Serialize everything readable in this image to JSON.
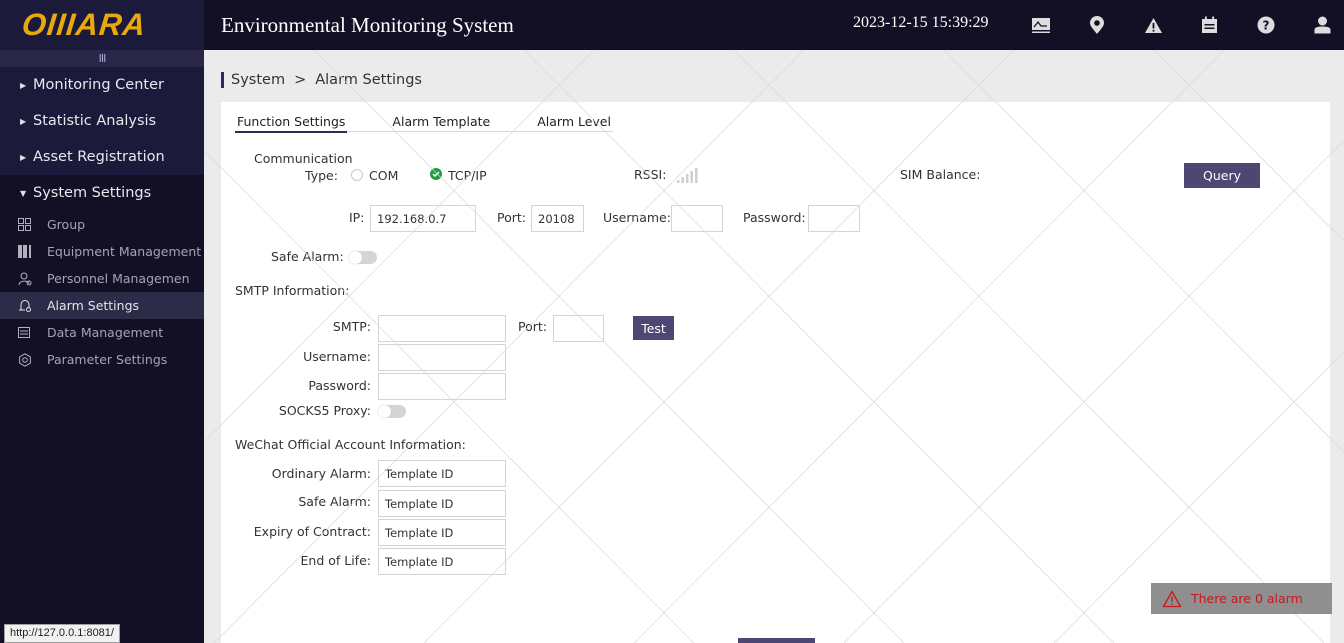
{
  "brand": {
    "logo": "OIIIARA",
    "collapse_glyph": "III"
  },
  "header": {
    "title": "Environmental Monitoring System",
    "datetime": "2023-12-15 15:39:29",
    "icons": [
      "chart-monitor-icon",
      "location-pin-icon",
      "warning-icon",
      "calendar-icon",
      "help-icon",
      "user-icon"
    ]
  },
  "sidebar": {
    "main_items": [
      {
        "label": "Monitoring Center",
        "expanded": false
      },
      {
        "label": "Statistic Analysis",
        "expanded": false
      },
      {
        "label": "Asset Registration",
        "expanded": false
      },
      {
        "label": "System Settings",
        "expanded": true
      }
    ],
    "sub_items": [
      {
        "label": "Group",
        "icon": "group-icon"
      },
      {
        "label": "Equipment Management",
        "icon": "equipment-icon"
      },
      {
        "label": "Personnel Managemen",
        "icon": "personnel-icon"
      },
      {
        "label": "Alarm Settings",
        "icon": "alarm-bell-icon",
        "active": true
      },
      {
        "label": "Data Management",
        "icon": "data-list-icon"
      },
      {
        "label": "Parameter Settings",
        "icon": "gear-icon"
      }
    ]
  },
  "breadcrumb": {
    "parent": "System",
    "separator": ">",
    "current": "Alarm Settings"
  },
  "tabs": [
    {
      "label": "Function Settings",
      "active": true
    },
    {
      "label": "Alarm Template",
      "active": false
    },
    {
      "label": "Alarm Level",
      "active": false
    }
  ],
  "communication": {
    "label_line1": "Communication",
    "label_line2": "Type:",
    "options": [
      {
        "label": "COM",
        "selected": false
      },
      {
        "label": "TCP/IP",
        "selected": true
      }
    ],
    "rssi_label": "RSSI:",
    "sim_balance_label": "SIM Balance:",
    "sim_balance_value": "",
    "query_button": "Query",
    "ip_label": "IP:",
    "ip_value": "192.168.0.7",
    "port_label": "Port:",
    "port_value": "20108",
    "username_label": "Username:",
    "username_value": "",
    "password_label": "Password:",
    "password_value": ""
  },
  "safe_alarm": {
    "label": "Safe Alarm:",
    "enabled": false
  },
  "smtp": {
    "section_label": "SMTP Information:",
    "smtp_label": "SMTP:",
    "smtp_value": "",
    "port_label": "Port:",
    "port_value": "",
    "test_button": "Test",
    "username_label": "Username:",
    "username_value": "",
    "password_label": "Password:",
    "password_value": "",
    "socks5_label": "SOCKS5 Proxy:",
    "socks5_enabled": false
  },
  "wechat": {
    "section_label": "WeChat Official Account Information:",
    "fields": [
      {
        "label": "Ordinary Alarm:",
        "value": "Template ID"
      },
      {
        "label": "Safe Alarm:",
        "value": "Template ID"
      },
      {
        "label": "Expiry of Contract:",
        "value": "Template ID"
      },
      {
        "label": "End of Life:",
        "value": "Template ID"
      }
    ]
  },
  "alarm_toast": {
    "text": "There are 0 alarm",
    "color": "#c8171e"
  },
  "status_bar": {
    "url": "http://127.0.0.1:8081/"
  },
  "colors": {
    "accent": "#4c4773",
    "logo": "#e9a90c",
    "nav_bg": "#131026",
    "success": "#1f9d3e"
  }
}
